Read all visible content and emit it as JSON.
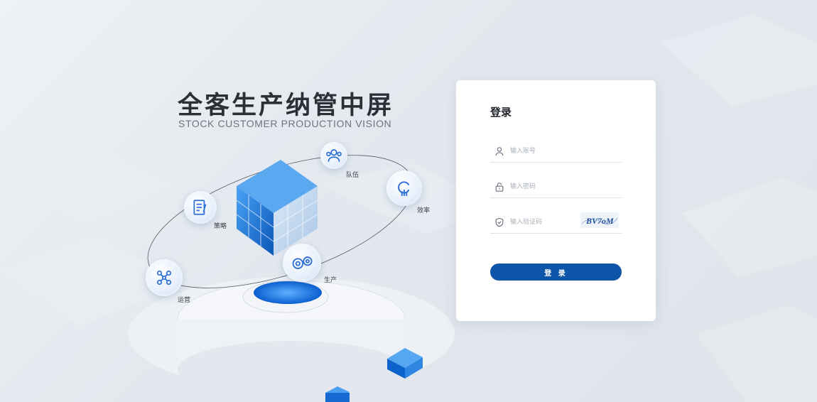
{
  "hero": {
    "title": "全客生产纳管中屏",
    "subtitle": "STOCK CUSTOMER PRODUCTION VISION"
  },
  "orbit_nodes": [
    {
      "label": "队伍",
      "icon": "team-icon"
    },
    {
      "label": "效率",
      "icon": "efficiency-icon"
    },
    {
      "label": "策略",
      "icon": "strategy-icon"
    },
    {
      "label": "生产",
      "icon": "gears-icon"
    },
    {
      "label": "运营",
      "icon": "operations-icon"
    }
  ],
  "login": {
    "title": "登录",
    "account_placeholder": "输入账号",
    "password_placeholder": "输入密码",
    "captcha_placeholder": "输入验证码",
    "captcha_text": "BV7oM",
    "button_label": "登 录"
  },
  "colors": {
    "accent": "#0c55a8",
    "cube_blue": "#1a7ee0",
    "background": "#e6eaef",
    "card": "#ffffff"
  }
}
